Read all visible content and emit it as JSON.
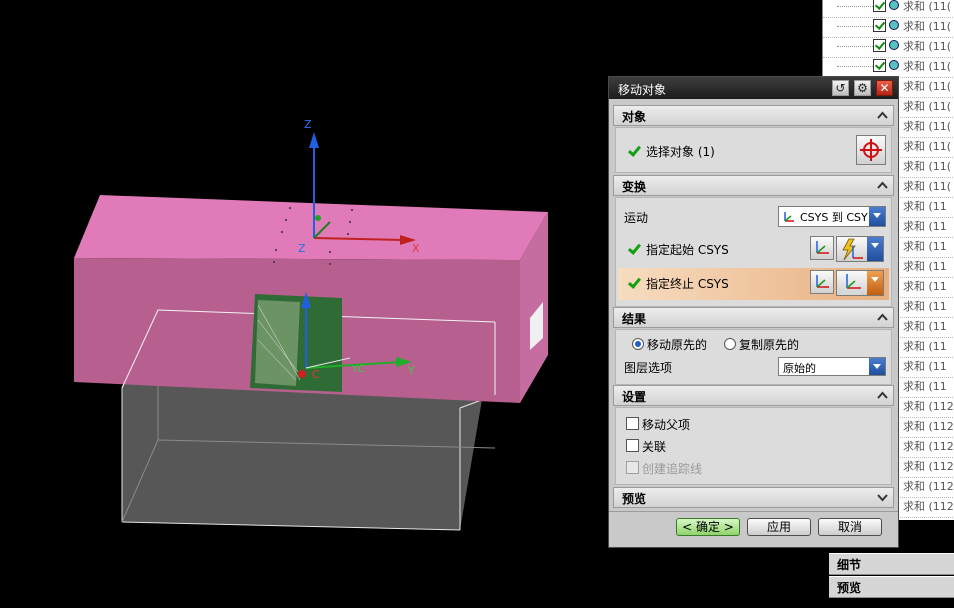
{
  "navigator": {
    "items": [
      {
        "label": "求和 (11("
      },
      {
        "label": "求和 (11("
      },
      {
        "label": "求和 (11("
      },
      {
        "label": "求和 (11("
      },
      {
        "label": "求和 (11("
      },
      {
        "label": "求和 (11("
      },
      {
        "label": "求和 (11("
      },
      {
        "label": "求和 (11("
      },
      {
        "label": "求和 (11("
      },
      {
        "label": "求和 (11("
      },
      {
        "label": "求和 (11"
      },
      {
        "label": "求和 (11"
      },
      {
        "label": "求和 (11"
      },
      {
        "label": "求和 (11"
      },
      {
        "label": "求和 (11"
      },
      {
        "label": "求和 (11"
      },
      {
        "label": "求和 (11"
      },
      {
        "label": "求和 (11"
      },
      {
        "label": "求和 (11"
      },
      {
        "label": "求和 (11"
      },
      {
        "label": "求和 (112"
      },
      {
        "label": "求和 (112"
      },
      {
        "label": "求和 (112"
      },
      {
        "label": "求和 (112"
      },
      {
        "label": "求和 (112"
      },
      {
        "label": "求和 (112"
      }
    ]
  },
  "side_panels": {
    "detail": "细节",
    "preview": "预览"
  },
  "dialog": {
    "title": "移动对象",
    "reset_icon": "↺",
    "settings_icon": "⚙",
    "close_icon": "✕",
    "object_section": {
      "header": "对象",
      "select_label": "选择对象 (1)"
    },
    "transform_section": {
      "header": "变换",
      "motion_label": "运动",
      "motion_value": "CSYS 到 CSY",
      "start_csys_label": "指定起始 CSYS",
      "end_csys_label": "指定终止 CSYS"
    },
    "result_section": {
      "header": "结果",
      "move_original": "移动原先的",
      "copy_original": "复制原先的",
      "layer_label": "图层选项",
      "layer_value": "原始的"
    },
    "settings_section": {
      "header": "设置",
      "move_parent": "移动父项",
      "associative": "关联",
      "create_trace": "创建追踪线"
    },
    "preview_section": {
      "header": "预览"
    },
    "buttons": {
      "ok": "< 确定 >",
      "apply": "应用",
      "cancel": "取消"
    }
  },
  "viewport": {
    "axis_z_top": "Z",
    "axis_x": "X",
    "axis_z_mid": "Z",
    "axis_yc": "YC",
    "axis_y": "Y",
    "axis_c": "C"
  },
  "colors": {
    "pink_block": "#e07ab8",
    "pink_front": "#b7608f",
    "green_part": "#2f6b35",
    "gray_block": "#555555",
    "accent_blue": "#1f4f9c",
    "check_green": "#13a013"
  }
}
